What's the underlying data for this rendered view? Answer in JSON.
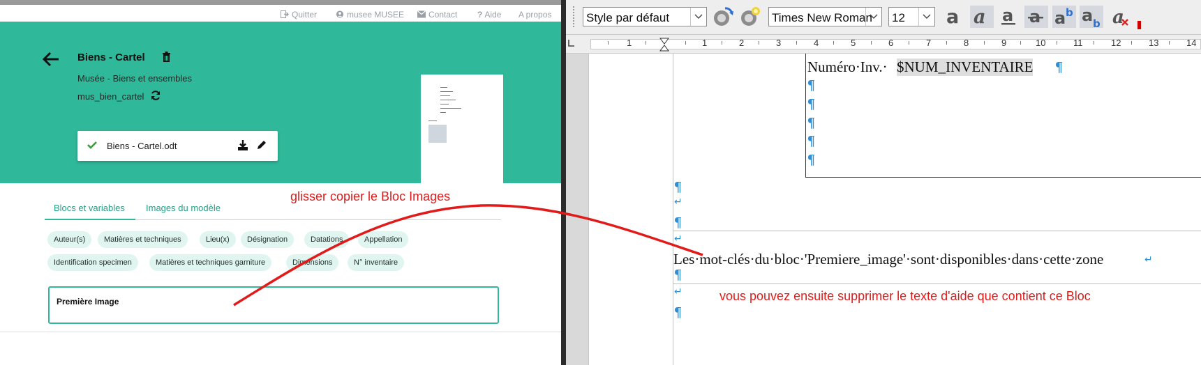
{
  "left_app": {
    "top_nav": {
      "items": [
        {
          "label": "Quitter",
          "icon": "sign-out-icon"
        },
        {
          "label": "musee MUSEE",
          "icon": "user-circle-icon"
        },
        {
          "label": "Contact",
          "icon": "envelope-icon"
        },
        {
          "label": "Aide",
          "icon": "question-icon"
        },
        {
          "label": "A propos",
          "icon": ""
        }
      ]
    },
    "header": {
      "title": "Biens - Cartel",
      "subtitle": "Musée - Biens et ensembles",
      "code": "mus_bien_cartel",
      "file_name": "Biens - Cartel.odt"
    },
    "tabs": [
      "Blocs et variables",
      "Images du modèle"
    ],
    "chips": [
      "Auteur(s)",
      "Matières et techniques",
      "Lieu(x)",
      "Désignation",
      "Datations",
      "Appellation",
      "Identification specimen",
      "Matières et techniques garniture",
      "Dimensions",
      "N° inventaire"
    ],
    "block_label": "Première Image",
    "colors": {
      "accent": "#2fb99a",
      "chip_bg": "#e0f5ef"
    }
  },
  "writer": {
    "paragraph_style": "Style par défaut",
    "font_name": "Times New Roman",
    "font_size": "12",
    "ruler_numbers": [
      "1",
      "1",
      "2",
      "3",
      "4",
      "5",
      "6",
      "7",
      "8",
      "9",
      "10",
      "11",
      "12",
      "13",
      "14"
    ],
    "doc_lines": {
      "inventory": "Numéro·Inv.·",
      "variable": "$NUM_INVENTAIRE",
      "help_text": "Les·mot-clés·du·bloc·'Premiere_image'·sont·disponibles·dans·cette·zone"
    },
    "pilcrow": "¶",
    "linebreak": "↵"
  },
  "annotations": {
    "drag_hint": "glisser copier le Bloc Images",
    "delete_hint": "vous pouvez ensuite supprimer le texte d'aide que contient ce Bloc",
    "color": "#e11a1a"
  }
}
